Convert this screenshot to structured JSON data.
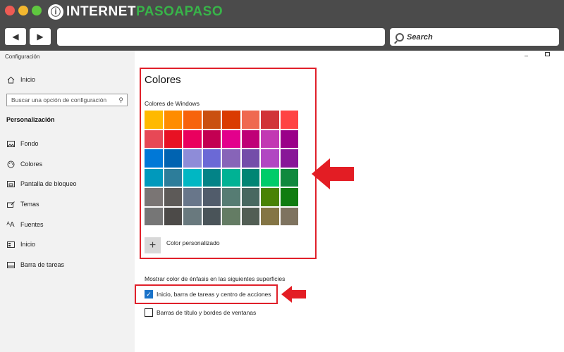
{
  "browser": {
    "logo_part1": "INTERNET",
    "logo_part2": "PASOAPASO",
    "search_placeholder": "Search",
    "back_icon": "left-arrow-icon",
    "forward_icon": "right-arrow-icon"
  },
  "window": {
    "title": "Configuración",
    "minimize_symbol": "–"
  },
  "sidebar": {
    "home": "Inicio",
    "search_placeholder": "Buscar una opción de configuración",
    "section_header": "Personalización",
    "items": [
      {
        "label": "Fondo",
        "icon": "picture-icon"
      },
      {
        "label": "Colores",
        "icon": "palette-icon"
      },
      {
        "label": "Pantalla de bloqueo",
        "icon": "lock-screen-icon"
      },
      {
        "label": "Temas",
        "icon": "brush-icon"
      },
      {
        "label": "Fuentes",
        "icon": "font-icon"
      },
      {
        "label": "Inicio",
        "icon": "start-icon"
      },
      {
        "label": "Barra de tareas",
        "icon": "taskbar-icon"
      }
    ]
  },
  "main": {
    "title": "Colores",
    "windows_colors_label": "Colores de Windows",
    "swatches": [
      "#FFB900",
      "#FF8C00",
      "#F7630C",
      "#CA5010",
      "#DA3B01",
      "#EF6950",
      "#D13438",
      "#FF4343",
      "#E74856",
      "#E81123",
      "#EA005E",
      "#C30052",
      "#E3008C",
      "#BF0077",
      "#C239B3",
      "#9A0089",
      "#0078D7",
      "#0063B1",
      "#8E8CD8",
      "#6B69D6",
      "#8764B8",
      "#744DA9",
      "#B146C2",
      "#881798",
      "#0099BC",
      "#2D7D9A",
      "#00B7C3",
      "#038387",
      "#00B294",
      "#018574",
      "#00CC6A",
      "#10893E",
      "#7A7574",
      "#5D5A58",
      "#68768A",
      "#515C6B",
      "#567C73",
      "#486860",
      "#498205",
      "#107C10",
      "#767676",
      "#4C4A48",
      "#69797E",
      "#4A5459",
      "#647C64",
      "#525E54",
      "#847545",
      "#7E735F"
    ],
    "custom_color_label": "Color personalizado",
    "accent_surfaces_label": "Mostrar color de énfasis en las siguientes superficies",
    "checkbox1_label": "Inicio, barra de tareas y centro de acciones",
    "checkbox1_checked": true,
    "checkbox2_label": "Barras de título y bordes de ventanas",
    "checkbox2_checked": false
  },
  "annotations": {
    "highlight_color": "#e0202a"
  }
}
